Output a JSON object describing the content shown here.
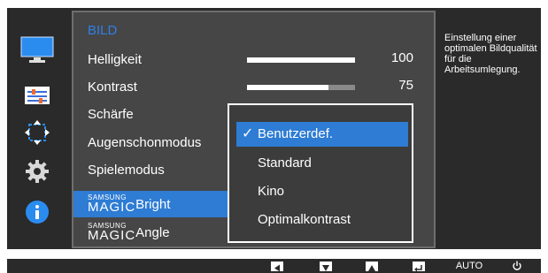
{
  "menu": {
    "title": "BILD",
    "items": [
      {
        "label": "Helligkeit",
        "value": "100",
        "level": 100
      },
      {
        "label": "Kontrast",
        "value": "75",
        "level": 75
      },
      {
        "label": "Schärfe"
      },
      {
        "label": "Augenschonmodus"
      },
      {
        "label": "Spielemodus"
      },
      {
        "brand_small": "SAMSUNG",
        "brand_big": "MAGIC",
        "label": "Bright"
      },
      {
        "brand_small": "SAMSUNG",
        "brand_big": "MAGIC",
        "label": "Angle"
      }
    ]
  },
  "dropdown": {
    "check_glyph": "✓",
    "options": [
      "Benutzerdef.",
      "Standard",
      "Kino",
      "Optimalkontrast"
    ],
    "selected": "Benutzerdef."
  },
  "help": {
    "text": "Einstellung einer optimalen Bildqualität für die Arbeitsumlegung."
  },
  "bottom_bar": {
    "auto_label": "AUTO",
    "buttons": [
      "left-arrow-icon",
      "down-arrow-icon",
      "up-arrow-icon",
      "enter-icon",
      "auto",
      "power-icon"
    ]
  },
  "side_icons": [
    "picture-icon",
    "osd-settings-icon",
    "position-icon",
    "gear-icon",
    "info-icon"
  ],
  "colors": {
    "accent": "#2e7cd4",
    "title": "#2f7fe6",
    "panel": "#464646",
    "background": "#2a2a2a"
  }
}
